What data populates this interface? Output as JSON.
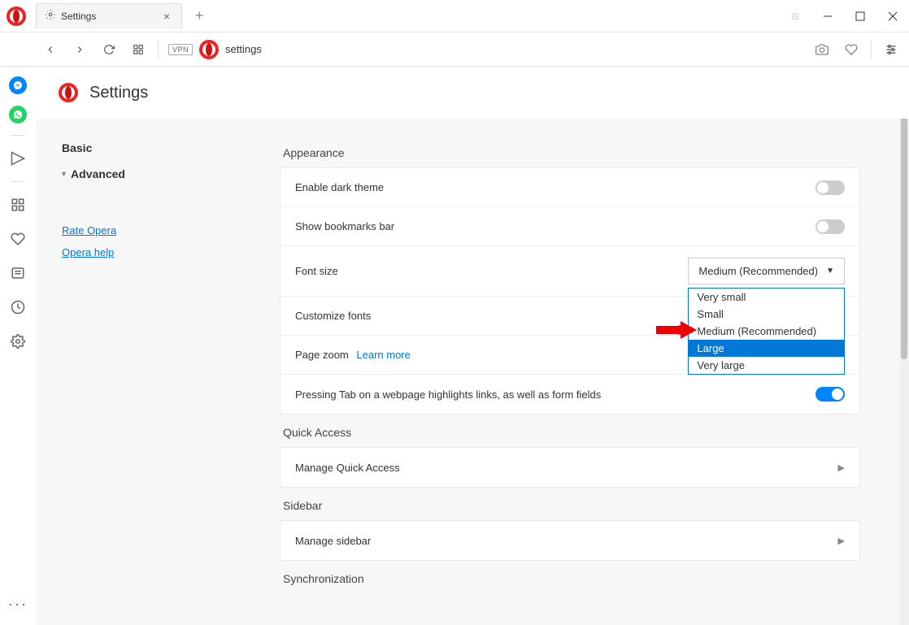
{
  "window": {
    "tab_title": "Settings",
    "address_text": "settings",
    "vpn_label": "VPN"
  },
  "settings_header": {
    "title": "Settings"
  },
  "sidenav": {
    "items": [
      {
        "label": "Basic",
        "bold": true,
        "caret": false
      },
      {
        "label": "Advanced",
        "bold": true,
        "caret": true
      }
    ],
    "links": [
      {
        "label": "Rate Opera"
      },
      {
        "label": "Opera help"
      }
    ]
  },
  "sections": {
    "appearance": {
      "title": "Appearance",
      "rows": {
        "dark_theme": "Enable dark theme",
        "bookmarks_bar": "Show bookmarks bar",
        "font_size": "Font size",
        "font_size_selected": "Medium (Recommended)",
        "font_size_options": [
          "Very small",
          "Small",
          "Medium (Recommended)",
          "Large",
          "Very large"
        ],
        "customize_fonts": "Customize fonts",
        "page_zoom": "Page zoom",
        "learn_more": "Learn more",
        "tab_highlight": "Pressing Tab on a webpage highlights links, as well as form fields"
      }
    },
    "quick_access": {
      "title": "Quick Access",
      "manage": "Manage Quick Access"
    },
    "sidebar": {
      "title": "Sidebar",
      "manage": "Manage sidebar"
    },
    "sync": {
      "title": "Synchronization"
    }
  },
  "dropdown_highlight_index": 3
}
